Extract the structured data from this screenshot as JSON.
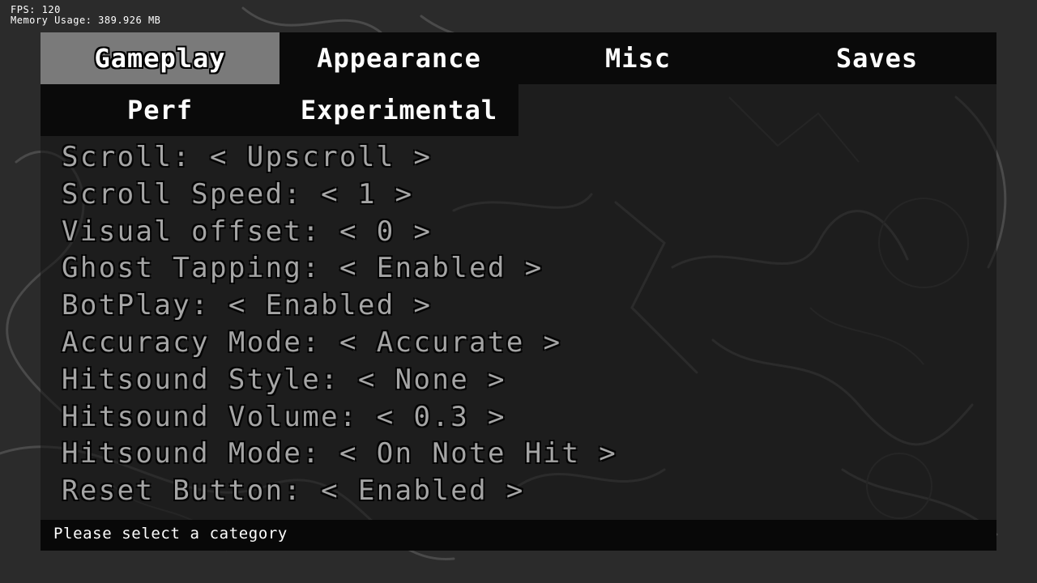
{
  "debug": {
    "fps": "FPS: 120",
    "memory": "Memory Usage: 389.926 MB"
  },
  "tabs": {
    "row1": [
      {
        "label": "Gameplay",
        "active": true
      },
      {
        "label": "Appearance",
        "active": false
      },
      {
        "label": "Misc",
        "active": false
      },
      {
        "label": "Saves",
        "active": false
      }
    ],
    "row2": [
      {
        "label": "Perf",
        "active": false
      },
      {
        "label": "Experimental",
        "active": false
      }
    ]
  },
  "options": [
    "Scroll: < Upscroll >",
    "Scroll Speed: < 1 >",
    "Visual offset: < 0 >",
    "Ghost Tapping: < Enabled >",
    "BotPlay: < Enabled >",
    "Accuracy Mode: < Accurate >",
    "Hitsound Style: < None >",
    "Hitsound Volume: < 0.3 >",
    "Hitsound Mode: < On Note Hit >",
    "Reset Button: < Enabled >"
  ],
  "footer": {
    "message": "Please select a category"
  },
  "colors": {
    "background": "#2b2b2b",
    "tab_bar": "#0a0a0a",
    "tab_active": "#7a7a7a",
    "option_text": "#bdbdbd",
    "footer_bar": "#080808"
  }
}
